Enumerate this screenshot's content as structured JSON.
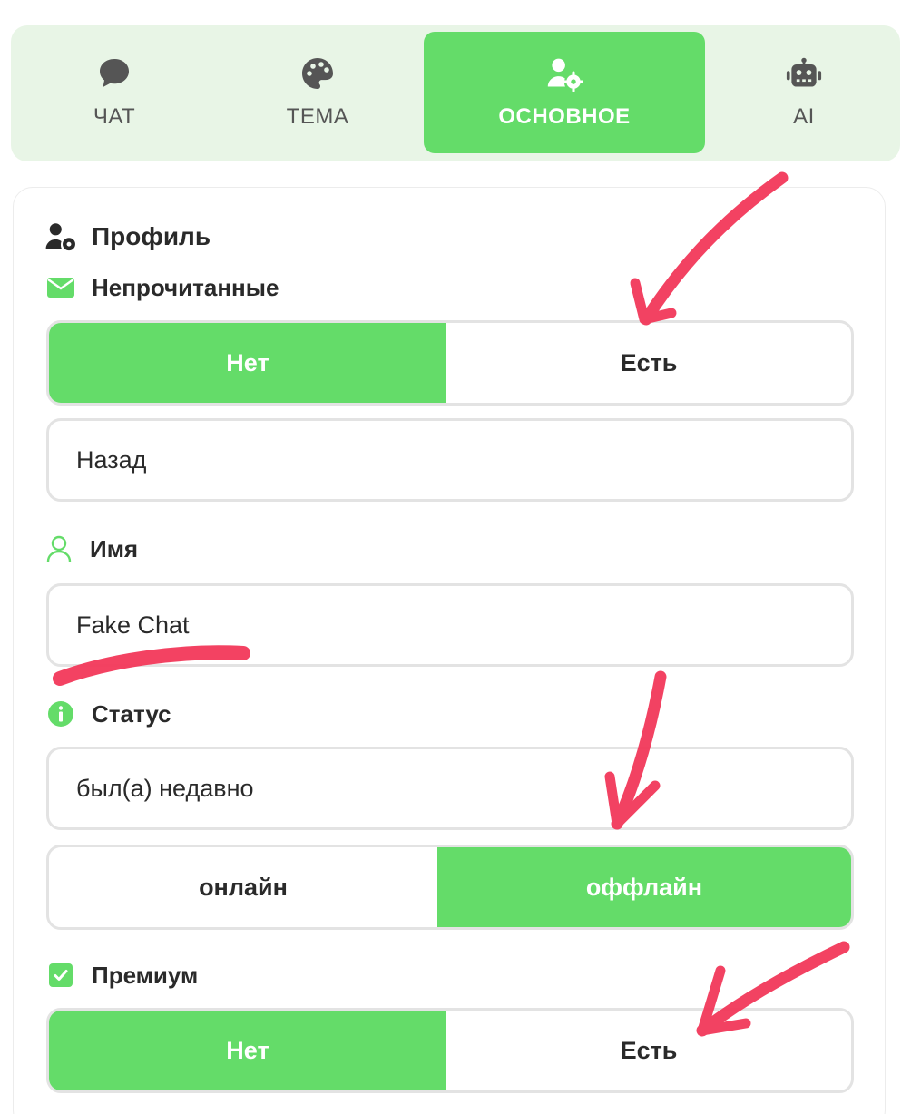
{
  "tabs": [
    {
      "label": "ЧАТ",
      "icon": "chat-bubble-icon",
      "active": false
    },
    {
      "label": "ТЕМА",
      "icon": "palette-icon",
      "active": false
    },
    {
      "label": "ОСНОВНОЕ",
      "icon": "user-gear-icon",
      "active": true
    },
    {
      "label": "AI",
      "icon": "robot-icon",
      "active": false
    }
  ],
  "profile": {
    "title": "Профиль",
    "unread": {
      "label": "Непрочитанные",
      "options": [
        "Нет",
        "Есть"
      ],
      "selected": "Нет",
      "input_value": "Назад"
    },
    "name": {
      "label": "Имя",
      "value": "Fake Chat"
    },
    "status": {
      "label": "Статус",
      "value": "был(а) недавно",
      "options": [
        "онлайн",
        "оффлайн"
      ],
      "selected": "оффлайн"
    },
    "premium": {
      "label": "Премиум",
      "options": [
        "Нет",
        "Есть"
      ],
      "selected": "Нет"
    }
  },
  "colors": {
    "accent": "#64dc69",
    "tab_bar_bg": "#e8f5e6",
    "annotation": "#f2385a"
  }
}
